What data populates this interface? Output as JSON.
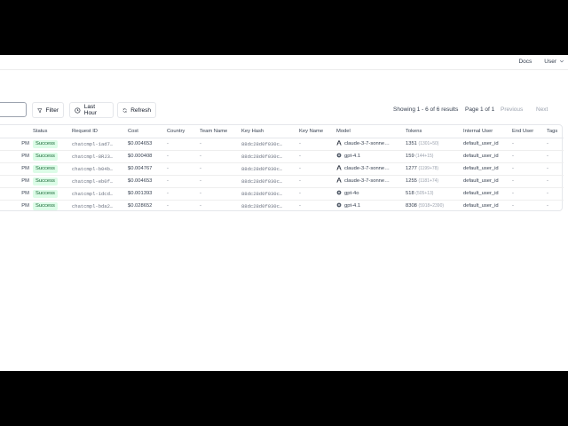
{
  "topbar": {
    "docs": "Docs",
    "user": "User"
  },
  "toolbar": {
    "filter_label": "Filter",
    "last_hour_label": "Last Hour",
    "refresh_label": "Refresh",
    "showing": "Showing 1 - 6 of 6 results",
    "page_of": "Page 1 of 1",
    "previous": "Previous",
    "next": "Next"
  },
  "table": {
    "columns": [
      "",
      "Status",
      "Request ID",
      "Cost",
      "Country",
      "Team Name",
      "Key Hash",
      "Key Name",
      "Model",
      "Tokens",
      "Internal User",
      "End User",
      "Tags"
    ],
    "rows": [
      {
        "time": "PM",
        "status": "Success",
        "request_id": "chatcmpl-1ad7…",
        "cost": "$0.004653",
        "country": "-",
        "team": "-",
        "key_hash": "88dc28d0f030c…",
        "key_name": "-",
        "model": "claude-3-7-sonne…",
        "provider": "anthropic",
        "tokens": "1351",
        "tokens_detail": "(1301+50)",
        "internal_user": "default_user_id",
        "end_user": "-",
        "tags": "-"
      },
      {
        "time": "PM",
        "status": "Success",
        "request_id": "chatcmpl-8RJ3…",
        "cost": "$0.000408",
        "country": "-",
        "team": "-",
        "key_hash": "88dc28d0f030c…",
        "key_name": "-",
        "model": "gpt-4.1",
        "provider": "openai",
        "tokens": "159",
        "tokens_detail": "(144+15)",
        "internal_user": "default_user_id",
        "end_user": "-",
        "tags": "-"
      },
      {
        "time": "PM",
        "status": "Success",
        "request_id": "chatcmpl-b04b…",
        "cost": "$0.004767",
        "country": "-",
        "team": "-",
        "key_hash": "88dc28d0f030c…",
        "key_name": "-",
        "model": "claude-3-7-sonne…",
        "provider": "anthropic",
        "tokens": "1277",
        "tokens_detail": "(1199+78)",
        "internal_user": "default_user_id",
        "end_user": "-",
        "tags": "-"
      },
      {
        "time": "PM",
        "status": "Success",
        "request_id": "chatcmpl-eb0f…",
        "cost": "$0.004653",
        "country": "-",
        "team": "-",
        "key_hash": "88dc28d0f030c…",
        "key_name": "-",
        "model": "claude-3-7-sonne…",
        "provider": "anthropic",
        "tokens": "1255",
        "tokens_detail": "(1181+74)",
        "internal_user": "default_user_id",
        "end_user": "-",
        "tags": "-"
      },
      {
        "time": "PM",
        "status": "Success",
        "request_id": "chatcmpl-1dcd…",
        "cost": "$0.001393",
        "country": "-",
        "team": "-",
        "key_hash": "88dc28d0f030c…",
        "key_name": "-",
        "model": "gpt-4o",
        "provider": "openai",
        "tokens": "518",
        "tokens_detail": "(505+13)",
        "internal_user": "default_user_id",
        "end_user": "-",
        "tags": "-"
      },
      {
        "time": "PM",
        "status": "Success",
        "request_id": "chatcmpl-bda2…",
        "cost": "$0.028652",
        "country": "-",
        "team": "-",
        "key_hash": "88dc28d0f030c…",
        "key_name": "-",
        "model": "gpt-4.1",
        "provider": "openai",
        "tokens": "8308",
        "tokens_detail": "(5918+2390)",
        "internal_user": "default_user_id",
        "end_user": "-",
        "tags": "-"
      }
    ]
  },
  "colors": {
    "success_bg": "#dcfce7",
    "success_text": "#166534",
    "border": "#e5e7eb",
    "muted_text": "#9ca3af"
  },
  "icons": {
    "filter": "filter-icon",
    "clock": "clock-icon",
    "refresh": "refresh-icon",
    "anthropic": "anthropic-logo-icon",
    "openai": "openai-logo-icon",
    "chevron": "chevron-down-icon"
  }
}
